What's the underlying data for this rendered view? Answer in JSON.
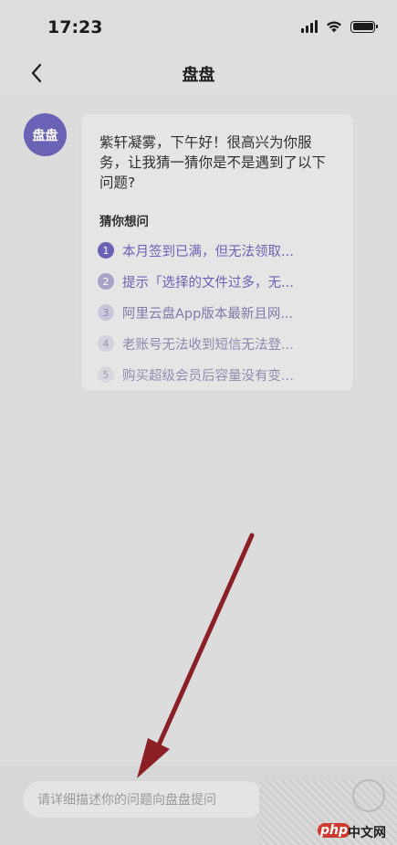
{
  "status_bar": {
    "time": "17:23"
  },
  "nav": {
    "title": "盘盘"
  },
  "assistant": {
    "avatar_text": "盘盘"
  },
  "message": {
    "greeting": "紫轩凝雾，下午好！很高兴为你服务，让我猜一猜你是不是遇到了以下问题?",
    "guess_heading": "猜你想问",
    "questions": [
      {
        "num": "1",
        "text": "本月签到已满，但无法领取..."
      },
      {
        "num": "2",
        "text": "提示「选择的文件过多，无..."
      },
      {
        "num": "3",
        "text": "阿里云盘App版本最新且网..."
      },
      {
        "num": "4",
        "text": "老账号无法收到短信无法登..."
      },
      {
        "num": "5",
        "text": "购买超级会员后容量没有变..."
      }
    ]
  },
  "input": {
    "placeholder": "请详细描述你的问题向盘盘提问"
  },
  "watermark": {
    "php": "php",
    "site": "中文网"
  },
  "colors": {
    "background": "#dcdcdd",
    "card": "#e6e5e6",
    "accent": "#6a62b4",
    "arrow": "#8a1f26"
  }
}
